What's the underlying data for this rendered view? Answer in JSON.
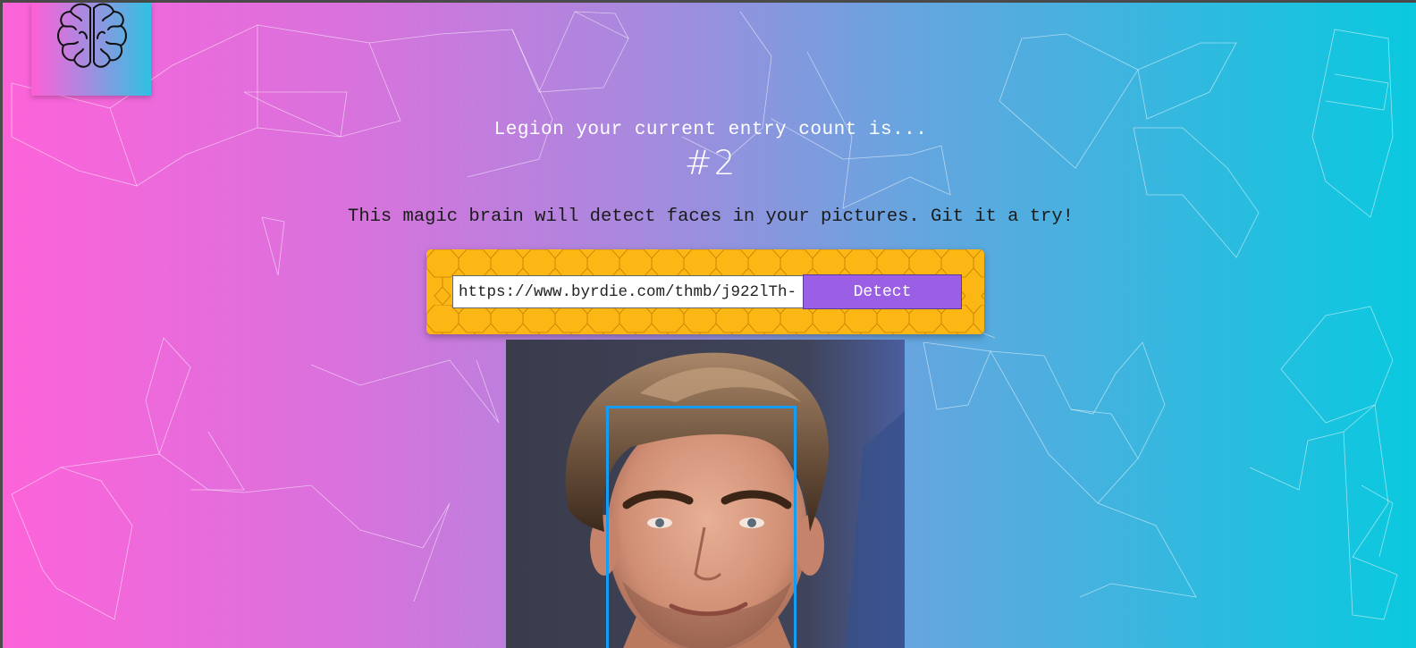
{
  "app": {
    "logo": {
      "icon": "brain-icon"
    }
  },
  "header": {
    "entry_message": "Legion your current entry count is...",
    "entry_rank": "#2"
  },
  "main": {
    "tagline": "This magic brain will detect faces in your pictures. Git it a try!",
    "url_input": {
      "value": "https://www.byrdie.com/thmb/j922lTh-"
    },
    "detect_button": {
      "label": "Detect"
    },
    "result_image": {
      "icon": "portrait-photo"
    }
  },
  "colors": {
    "gradient_left": "#fd63d9",
    "gradient_right": "#0ac9df",
    "panel": "#fdb714",
    "button": "#9b5fe6",
    "face_box": "#149df2"
  }
}
